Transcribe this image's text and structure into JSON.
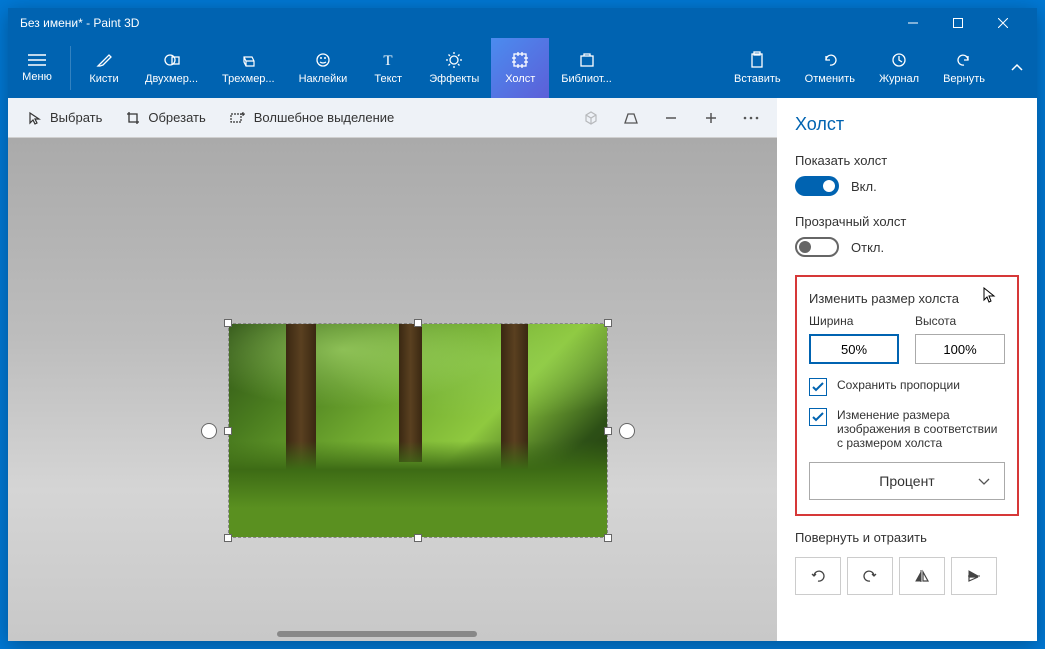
{
  "window": {
    "title": "Без имени* - Paint 3D"
  },
  "ribbon": {
    "menu": "Меню",
    "brushes": "Кисти",
    "shapes2d": "Двухмер...",
    "shapes3d": "Трехмер...",
    "stickers": "Наклейки",
    "text": "Текст",
    "effects": "Эффекты",
    "canvas": "Холст",
    "library": "Библиот...",
    "paste": "Вставить",
    "undo": "Отменить",
    "history": "Журнал",
    "redo": "Вернуть"
  },
  "toolbar": {
    "select": "Выбрать",
    "crop": "Обрезать",
    "magic": "Волшебное выделение"
  },
  "panel": {
    "title": "Холст",
    "show_canvas": "Показать холст",
    "on": "Вкл.",
    "transparent": "Прозрачный холст",
    "off": "Откл.",
    "resize_title": "Изменить размер холста",
    "width_label": "Ширина",
    "height_label": "Высота",
    "width_value": "50%",
    "height_value": "100%",
    "lock_aspect": "Сохранить пропорции",
    "resize_image": "Изменение размера изображения в соответствии с размером холста",
    "unit": "Процент",
    "rotate_title": "Повернуть и отразить"
  }
}
